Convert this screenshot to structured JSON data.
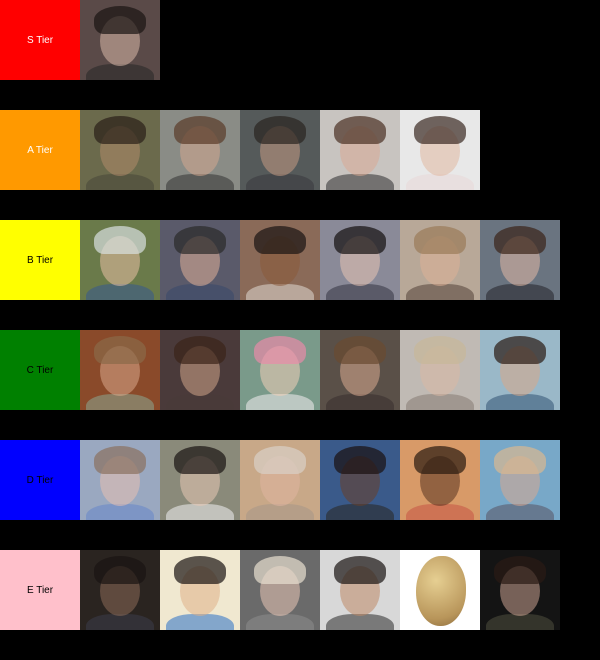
{
  "tiers": [
    {
      "label": "S Tier",
      "color": "#ff0000",
      "text_color": "#ffffff",
      "items": [
        {
          "name": "crying-woman-dark-hair",
          "bg": "#5a4a48",
          "skin": "#d9b8a8",
          "hair": "#1a1412",
          "top": "#2a2a2a"
        }
      ]
    },
    {
      "label": "A Tier",
      "color": "#ff9900",
      "text_color": "#ffffff",
      "items": [
        {
          "name": "boy-hand-on-head",
          "bg": "#6b6a4c",
          "skin": "#b08a6a",
          "hair": "#2a2018",
          "top": "#4a4a3a"
        },
        {
          "name": "woman-brown-hair-crying",
          "bg": "#8a8c86",
          "skin": "#d4a890",
          "hair": "#5a3a28",
          "top": "#3a3a3a"
        },
        {
          "name": "young-man-grimacing",
          "bg": "#555a5a",
          "skin": "#c49a84",
          "hair": "#2a2420",
          "top": "#3a3a40"
        },
        {
          "name": "woman-crying-open-mouth",
          "bg": "#c8c4c0",
          "skin": "#d8aa94",
          "hair": "#4a3024",
          "top": "#3a3a3a"
        },
        {
          "name": "child-laughing-crying",
          "bg": "#e8e8e8",
          "skin": "#e0b8a0",
          "hair": "#3a2a22",
          "top": "#e8d8d8"
        }
      ]
    },
    {
      "label": "B Tier",
      "color": "#ffff00",
      "text_color": "#000000",
      "items": [
        {
          "name": "woman-headscarf-crying",
          "bg": "#6a7a4a",
          "skin": "#e8c0a4",
          "hair": "#d8e0e0",
          "top": "#3a5a8a"
        },
        {
          "name": "man-glasses-hand-on-face",
          "bg": "#5a5a6a",
          "skin": "#e0b098",
          "hair": "#2a2a2a",
          "top": "#3a4a6a"
        },
        {
          "name": "man-leaning-collage",
          "bg": "#8a6a58",
          "skin": "#8a5a3a",
          "hair": "#1a1412",
          "top": "#d8d0c8"
        },
        {
          "name": "woman-black-bangs-sad",
          "bg": "#8a8a98",
          "skin": "#e8c4b4",
          "hair": "#141010",
          "top": "#3a3a48"
        },
        {
          "name": "woman-blonde-hand-cheek",
          "bg": "#b8a898",
          "skin": "#dcb098",
          "hair": "#9a7a58",
          "top": "#5a4a40"
        },
        {
          "name": "woman-disgusted-face",
          "bg": "#6a7480",
          "skin": "#e0b8a4",
          "hair": "#3a2418",
          "top": "#2a2a30"
        }
      ]
    },
    {
      "label": "C Tier",
      "color": "#008000",
      "text_color": "#000000",
      "items": [
        {
          "name": "man-glasses-smiling",
          "bg": "#8a4a2a",
          "skin": "#d8a88a",
          "hair": "#8a6a48",
          "top": "#8aa08a"
        },
        {
          "name": "woman-dark-hair-shocked",
          "bg": "#4a3a3a",
          "skin": "#d0a488",
          "hair": "#3a2418",
          "top": "#4a3a38"
        },
        {
          "name": "woman-pink-knit-hat",
          "bg": "#7a9a8a",
          "skin": "#f0d0b8",
          "hair": "#e88aa8",
          "top": "#e8e8e8"
        },
        {
          "name": "woman-raised-eyebrow",
          "bg": "#5a5048",
          "skin": "#d8aa90",
          "hair": "#6a4a30",
          "top": "#3a3030"
        },
        {
          "name": "blurry-woman-blonde",
          "bg": "#c0bab4",
          "skin": "#d8b8a4",
          "hair": "#c8b898",
          "top": "#8a8078"
        },
        {
          "name": "man-smiling-palm-trees",
          "bg": "#9ab8c8",
          "skin": "#d8a888",
          "hair": "#2a1a12",
          "top": "#3a5a7a"
        }
      ]
    },
    {
      "label": "D Tier",
      "color": "#0000ff",
      "text_color": "#000000",
      "items": [
        {
          "name": "baby-crying",
          "bg": "#9aa8c0",
          "skin": "#e8c0b0",
          "hair": "#8a7060",
          "top": "#6a88c8"
        },
        {
          "name": "toddler-girl-pigtails",
          "bg": "#8a8a7a",
          "skin": "#e8c8b4",
          "hair": "#1a1412",
          "top": "#e8e8e8"
        },
        {
          "name": "old-woman-screaming",
          "bg": "#c8a888",
          "skin": "#e0b4a0",
          "hair": "#d8d0c8",
          "top": "#a89888"
        },
        {
          "name": "man-dancing-tank-top",
          "bg": "#3a5a8a",
          "skin": "#6a4028",
          "hair": "#1a1010",
          "top": "#2a2a2a"
        },
        {
          "name": "girl-braids-smiling",
          "bg": "#d89a68",
          "skin": "#5a3420",
          "hair": "#2a1a10",
          "top": "#c85a48"
        },
        {
          "name": "woman-spiky-blonde-hair",
          "bg": "#78a8c8",
          "skin": "#d8a890",
          "hair": "#d8b890",
          "top": "#5a5a6a"
        }
      ]
    },
    {
      "label": "E Tier",
      "color": "#ffc0cb",
      "text_color": "#000000",
      "items": [
        {
          "name": "person-dark-room",
          "bg": "#2a2420",
          "skin": "#8a6a58",
          "hair": "#1a1412",
          "top": "#3a3a48"
        },
        {
          "name": "young-man-blue-shirt",
          "bg": "#f0e8d0",
          "skin": "#e0b088",
          "hair": "#1a1412",
          "top": "#3a7ac8"
        },
        {
          "name": "blonde-woman-closeup",
          "bg": "#6a6a6a",
          "skin": "#e8c4b4",
          "hair": "#e8e0d0",
          "top": "#8a8a8a"
        },
        {
          "name": "man-beard-dark-hair",
          "bg": "#d8d8d8",
          "skin": "#c08a68",
          "hair": "#1a1412",
          "top": "#3a3a3a"
        },
        {
          "name": "potato",
          "bg": "#ffffff",
          "potato": true
        },
        {
          "name": "man-dark-background",
          "bg": "#141414",
          "skin": "#c8a090",
          "hair": "#2a1a14",
          "top": "#4a4a3a"
        }
      ]
    }
  ]
}
